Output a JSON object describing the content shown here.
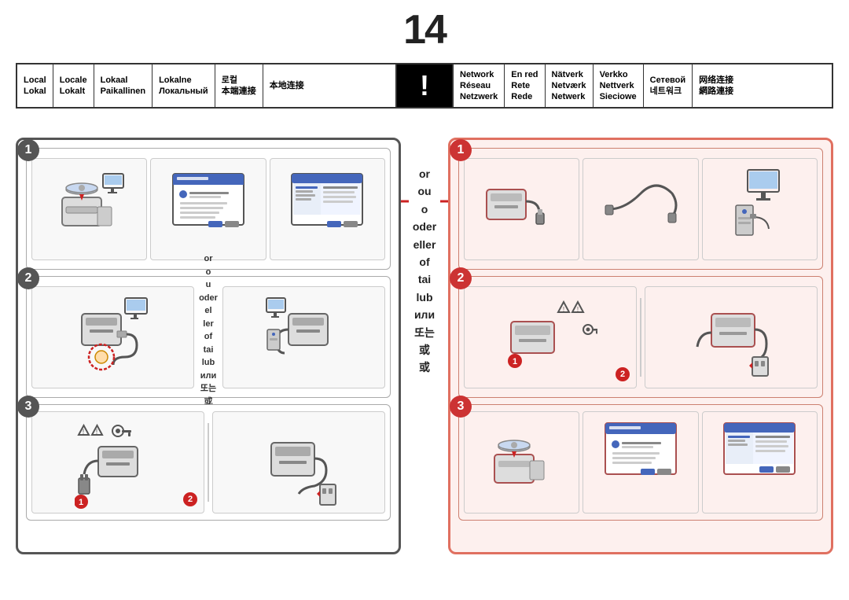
{
  "step_number": "14",
  "header": {
    "left_cells": [
      {
        "line1": "Local",
        "line2": "Lokal"
      },
      {
        "line1": "Locale",
        "line2": "Lokalt"
      },
      {
        "line1": "Lokaal",
        "line2": "Paikallinen"
      },
      {
        "line1": "Lokalne",
        "line2": "Локальный"
      },
      {
        "line1": "로컬",
        "line2": "本端連接"
      },
      {
        "line1": "本地连接",
        "line2": ""
      }
    ],
    "right_cells": [
      {
        "line1": "Network",
        "line2": "Réseau",
        "line3": "Netzwerk"
      },
      {
        "line1": "En red",
        "line2": "Rete",
        "line3": "Rede"
      },
      {
        "line1": "Nätverk",
        "line2": "Netværk",
        "line3": "Netwerk"
      },
      {
        "line1": "Verkko",
        "line2": "Nettverk",
        "line3": "Sieciowe"
      },
      {
        "line1": "Сетевой",
        "line2": "네트워크"
      },
      {
        "line1": "网络连接",
        "line2": "網路連接"
      }
    ]
  },
  "center": {
    "or_lines": [
      "or",
      "ou",
      "o",
      "oder",
      "eller",
      "of",
      "tai",
      "lub",
      "или",
      "또는",
      "或",
      "或"
    ]
  },
  "left_panel": {
    "steps": [
      {
        "num": "1",
        "panels": [
          "cd_install",
          "software_screen",
          "settings_screen"
        ]
      },
      {
        "num": "2",
        "panels": [
          "printer_cable_local",
          "or",
          "pc_cable_local"
        ]
      },
      {
        "num": "3",
        "panels": [
          "printer_connect",
          "divider",
          "printer_connect2"
        ]
      }
    ]
  },
  "right_panel": {
    "steps": [
      {
        "num": "1",
        "panels": [
          "printer_cable_net",
          "cable_run",
          "pc_network"
        ]
      },
      {
        "num": "2",
        "panels": [
          "printer_network_connect",
          "warning_key",
          "divider",
          "printer_network_connect2"
        ]
      },
      {
        "num": "3",
        "panels": [
          "cd_install_net",
          "software_screen_net",
          "settings_screen_net"
        ]
      }
    ]
  },
  "badges": {
    "badge1": "1",
    "badge2": "2"
  }
}
